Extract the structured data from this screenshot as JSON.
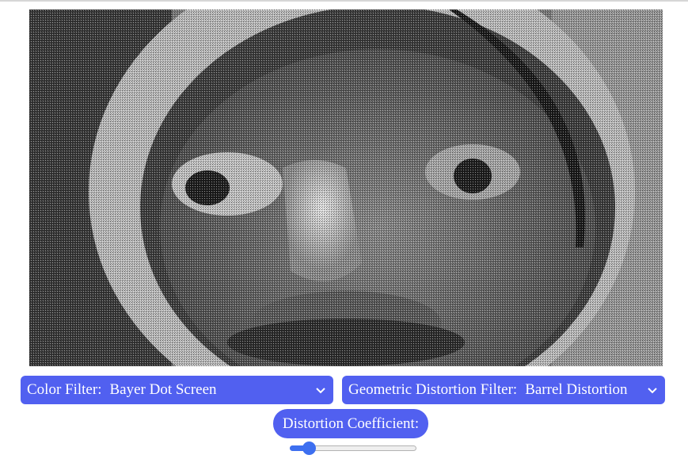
{
  "color_filter": {
    "label": "Color Filter:",
    "selected": "Bayer Dot Screen",
    "icon": "chevron-down-icon"
  },
  "geometric_filter": {
    "label": "Geometric Distortion Filter:",
    "selected": "Barrel Distortion",
    "icon": "chevron-down-icon"
  },
  "distortion": {
    "label": "Distortion Coefficient:",
    "value_fraction": 0.11
  },
  "colors": {
    "accent": "#5160f0",
    "slider": "#3d6ff0"
  }
}
